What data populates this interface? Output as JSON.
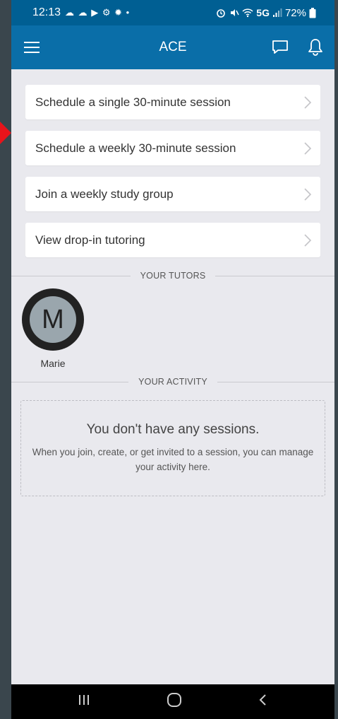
{
  "status_bar": {
    "time": "12:13",
    "left_icons_glyph": "☁ ☁ ▶ ⚙ ✹ •",
    "network": "5G",
    "battery": "72%"
  },
  "app_bar": {
    "title": "ACE"
  },
  "menu": {
    "items": [
      {
        "label": "Schedule a single 30-minute session"
      },
      {
        "label": "Schedule a weekly 30-minute session"
      },
      {
        "label": "Join a weekly study group"
      },
      {
        "label": "View drop-in tutoring"
      }
    ]
  },
  "tutors": {
    "heading": "YOUR TUTORS",
    "list": [
      {
        "initial": "M",
        "name": "Marie"
      }
    ]
  },
  "activity": {
    "heading": "YOUR ACTIVITY",
    "empty_title": "You don't have any sessions.",
    "empty_text": "When you join, create, or get invited to a session, you can manage your activity here."
  },
  "colors": {
    "status_bar": "#005f93",
    "app_bar": "#0a6ea8",
    "background": "#e9e9ee",
    "pointer_arrow": "#e8141b"
  }
}
